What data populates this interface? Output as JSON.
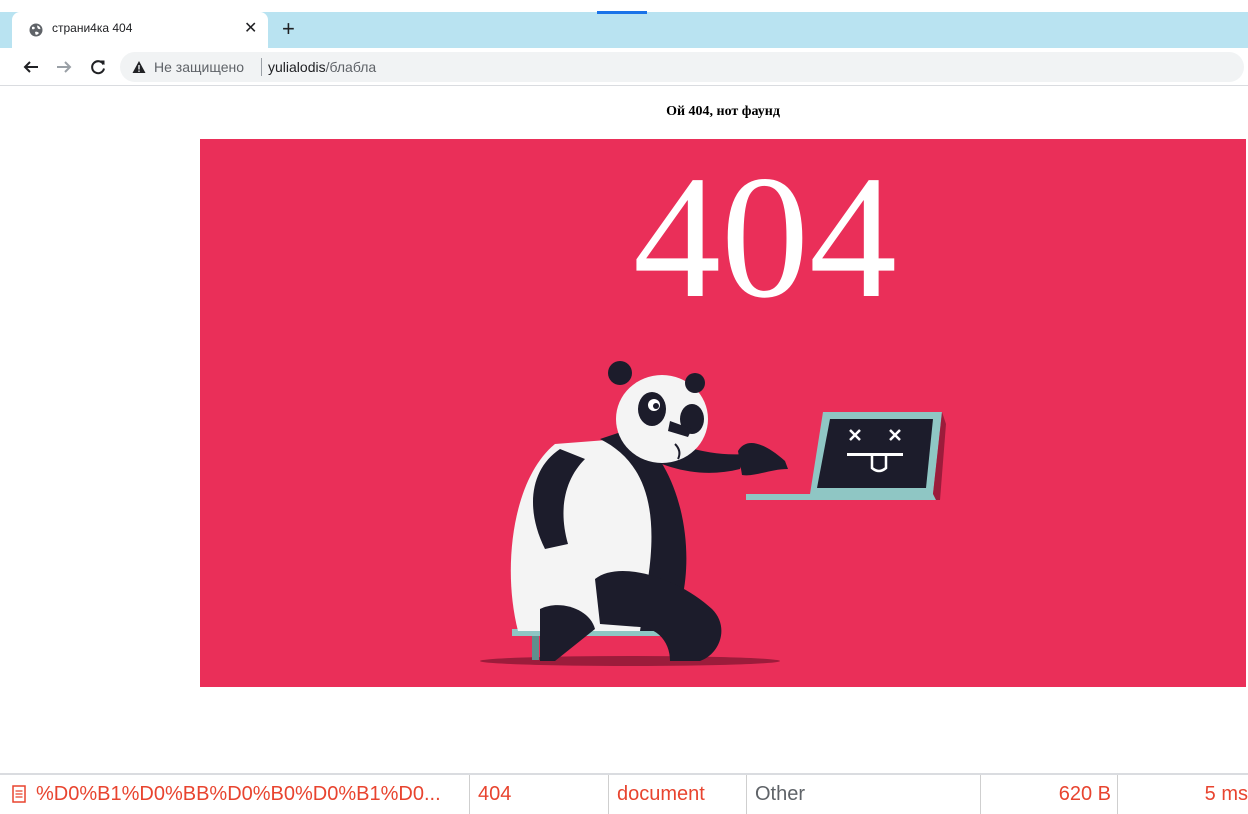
{
  "browser": {
    "tab": {
      "title": "страни4ка 404",
      "close_glyph": "✕",
      "new_tab_glyph": "+"
    },
    "toolbar": {
      "back_glyph": "←",
      "forward_glyph": "→",
      "reload_glyph": "C",
      "security_label": "Не защищено",
      "url_host": "yulialodis",
      "url_path": "/блабла"
    }
  },
  "page": {
    "heading": "Ой 404, нот фаунд",
    "hero_text": "404",
    "hero_background": "#ea2f59"
  },
  "network_row": {
    "name": "%D0%B1%D0%BB%D0%B0%D0%B1%D0...",
    "status": "404",
    "type": "document",
    "initiator": "Other",
    "size": "620 B",
    "time": "5 ms"
  },
  "colors": {
    "tabstrip": "#b9e3f1",
    "panda_dark": "#1c1c2b",
    "laptop_teal": "#8fc6c4",
    "error_red": "#e8442f"
  },
  "icons": [
    "globe-icon",
    "close-icon",
    "plus-icon",
    "back-arrow-icon",
    "forward-arrow-icon",
    "reload-icon",
    "warning-icon",
    "document-icon"
  ]
}
